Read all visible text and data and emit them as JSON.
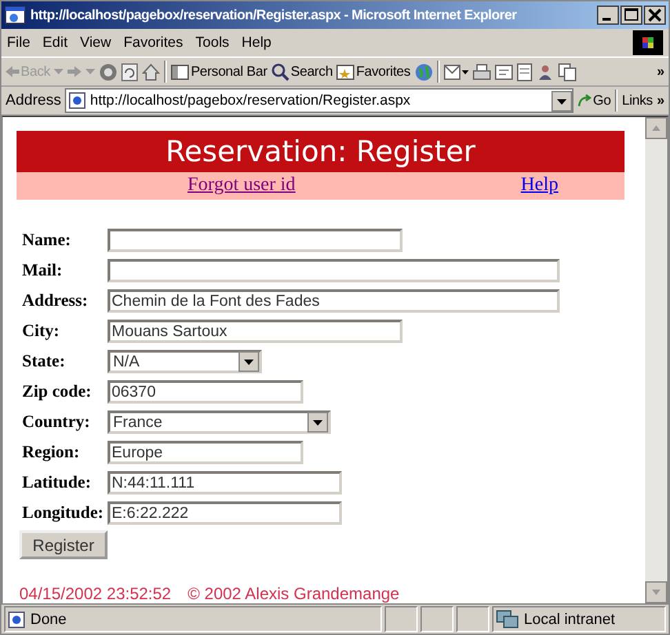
{
  "window": {
    "title": "http://localhost/pagebox/reservation/Register.aspx - Microsoft Internet Explorer"
  },
  "menu": [
    "File",
    "Edit",
    "View",
    "Favorites",
    "Tools",
    "Help"
  ],
  "toolbar": {
    "back": {
      "label": "Back",
      "disabled": true
    },
    "buttons": [
      "Personal Bar",
      "Search",
      "Favorites"
    ],
    "more": "»"
  },
  "address_bar": {
    "label": "Address",
    "url": "http://localhost/pagebox/reservation/Register.aspx",
    "go": "Go",
    "links": "Links",
    "more": "»"
  },
  "page": {
    "title": "Reservation: Register",
    "links": [
      {
        "label": "Forgot user id",
        "visited": true
      },
      {
        "label": "Help",
        "visited": false
      }
    ],
    "fields": [
      {
        "label": "Name:",
        "kind": "text"
      },
      {
        "label": "Mail:",
        "kind": "text"
      },
      {
        "label": "Address:",
        "kind": "text",
        "value": "Chemin de la Font des Fades"
      },
      {
        "label": "City:",
        "kind": "text",
        "value": "Mouans Sartoux"
      },
      {
        "label": "State:",
        "kind": "select",
        "value": "N/A"
      },
      {
        "label": "Zip code:",
        "kind": "text",
        "value": "06370"
      },
      {
        "label": "Country:",
        "kind": "select",
        "value": "France"
      },
      {
        "label": "Region:",
        "kind": "text",
        "value": "Europe"
      },
      {
        "label": "Latitude:",
        "kind": "text",
        "value": "N:44:11.111"
      },
      {
        "label": "Longitude:",
        "kind": "text",
        "value": "E:6:22.222"
      }
    ],
    "submit": "Register",
    "timestamp": "04/15/2002 23:52:52",
    "copyright": "© 2002 Alexis Grandemange"
  },
  "status_bar": {
    "text": "Done",
    "zone": "Local intranet"
  }
}
